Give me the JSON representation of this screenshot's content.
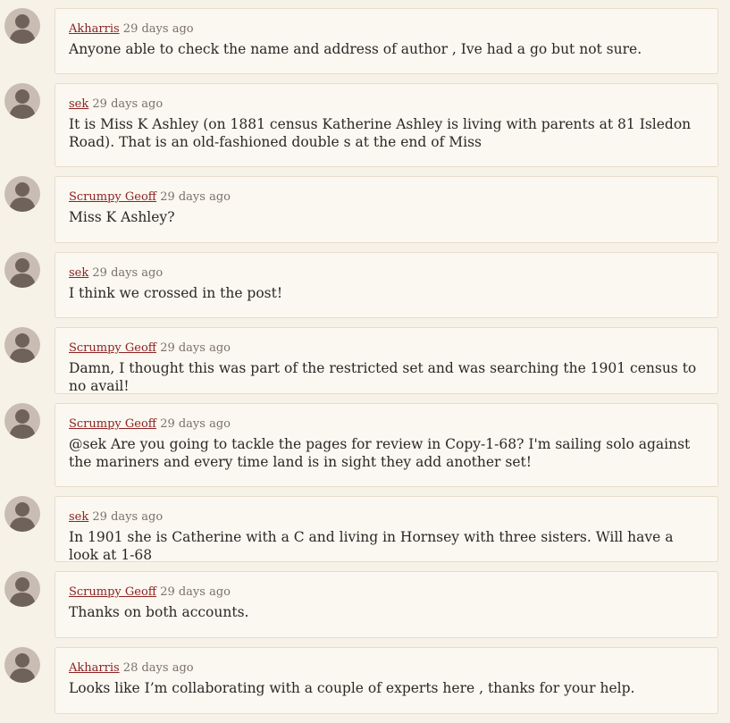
{
  "comments": [
    {
      "author": "Akharris",
      "time": "29 days ago",
      "text": "Anyone able to check the name and address of author , Ive had a go but not sure."
    },
    {
      "author": "sek",
      "time": "29 days ago",
      "text": "It is Miss K Ashley (on 1881 census Katherine Ashley is living with parents at 81 Isledon Road). That is an old-fashioned double s at the end of Miss"
    },
    {
      "author": "Scrumpy Geoff",
      "time": "29 days ago",
      "text": "Miss K Ashley?"
    },
    {
      "author": "sek",
      "time": "29 days ago",
      "text": "I think we crossed in the post!"
    },
    {
      "author": "Scrumpy Geoff",
      "time": "29 days ago",
      "text": "Damn, I thought this was part of the restricted set and was searching the 1901 census to no avail!"
    },
    {
      "author": "Scrumpy Geoff",
      "time": "29 days ago",
      "text": "@sek Are you going to tackle the pages for review in Copy-1-68? I'm sailing solo against the mariners and every time land is in sight they add another set!"
    },
    {
      "author": "sek",
      "time": "29 days ago",
      "text": "In 1901 she is Catherine with a C and living in Hornsey with three sisters. Will have a look at 1-68"
    },
    {
      "author": "Scrumpy Geoff",
      "time": "29 days ago",
      "text": "Thanks on both accounts."
    },
    {
      "author": "Akharris",
      "time": "28 days ago",
      "text": "Looks like I’m collaborating with a couple of experts here , thanks for your help."
    }
  ],
  "icons": {
    "avatar": "user-silhouette-icon"
  },
  "colors": {
    "background": "#f7f2e8",
    "card": "#fbf8f1",
    "author_link": "#8b2323",
    "avatar_bg": "#c9bdb3",
    "avatar_fg": "#6e625b"
  }
}
